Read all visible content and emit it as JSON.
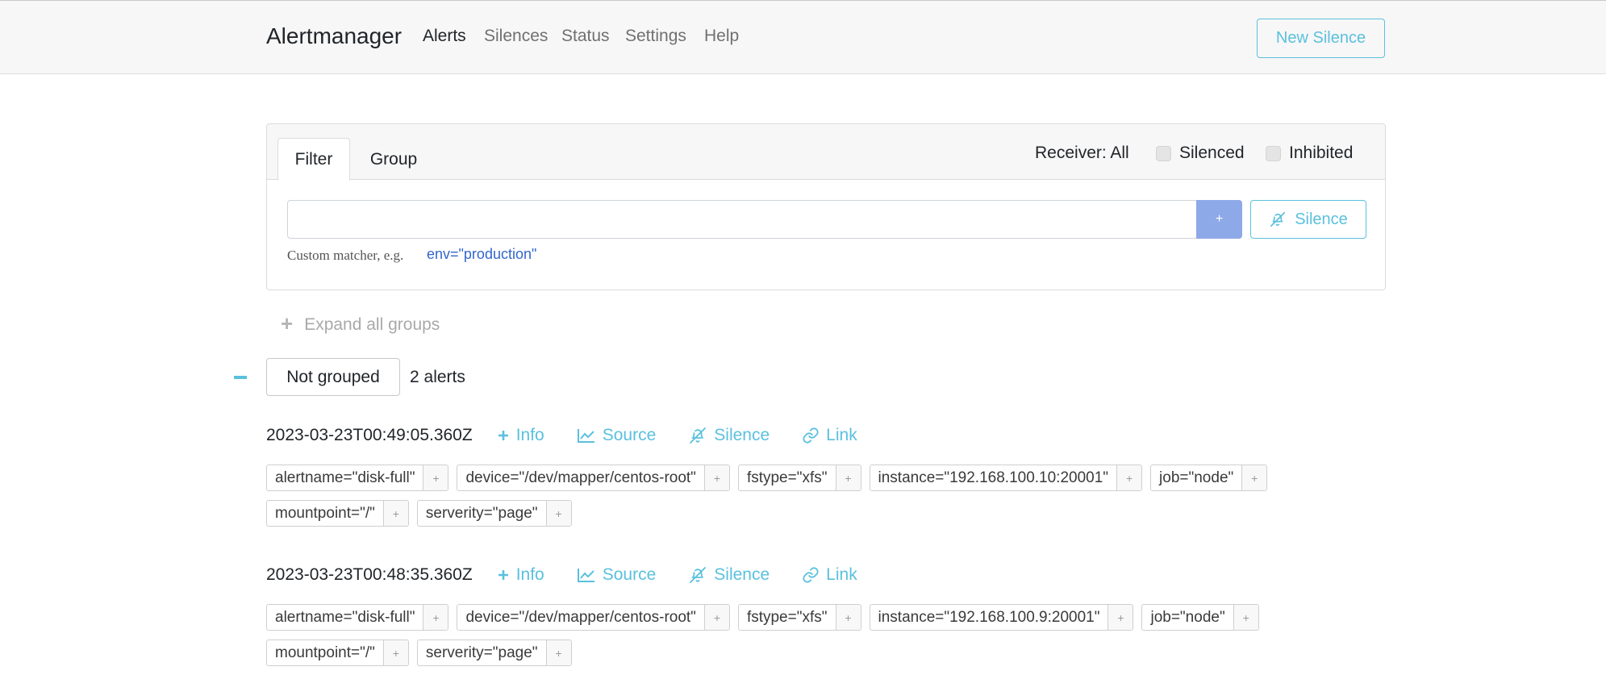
{
  "navbar": {
    "brand": "Alertmanager",
    "links": [
      "Alerts",
      "Silences",
      "Status",
      "Settings",
      "Help"
    ],
    "new_silence": "New Silence"
  },
  "filter": {
    "tabs": [
      "Filter",
      "Group"
    ],
    "receiver": "Receiver: All",
    "silenced_label": "Silenced",
    "inhibited_label": "Inhibited",
    "input_value": "",
    "plus_label": "+",
    "silence_button": "Silence",
    "hint": "Custom matcher, e.g.",
    "hint_example": "env=\"production\""
  },
  "expand_all": {
    "icon": "+",
    "label": "Expand all groups"
  },
  "group": {
    "name": "Not grouped",
    "count": "2 alerts"
  },
  "actions": {
    "info": "Info",
    "source": "Source",
    "silence": "Silence",
    "link": "Link"
  },
  "alerts": [
    {
      "timestamp": "2023-03-23T00:49:05.360Z",
      "labels": [
        [
          "alertname=\"disk-full\"",
          "device=\"/dev/mapper/centos-root\"",
          "fstype=\"xfs\"",
          "instance=\"192.168.100.10:20001\"",
          "job=\"node\""
        ],
        [
          "mountpoint=\"/\"",
          "serverity=\"page\""
        ]
      ]
    },
    {
      "timestamp": "2023-03-23T00:48:35.360Z",
      "labels": [
        [
          "alertname=\"disk-full\"",
          "device=\"/dev/mapper/centos-root\"",
          "fstype=\"xfs\"",
          "instance=\"192.168.100.9:20001\"",
          "job=\"node\""
        ],
        [
          "mountpoint=\"/\"",
          "serverity=\"page\""
        ]
      ]
    }
  ],
  "label_plus": "+",
  "colors": {
    "accent": "#5bc0de",
    "primary_button": "#8ea9e8",
    "link": "#3366cc"
  }
}
